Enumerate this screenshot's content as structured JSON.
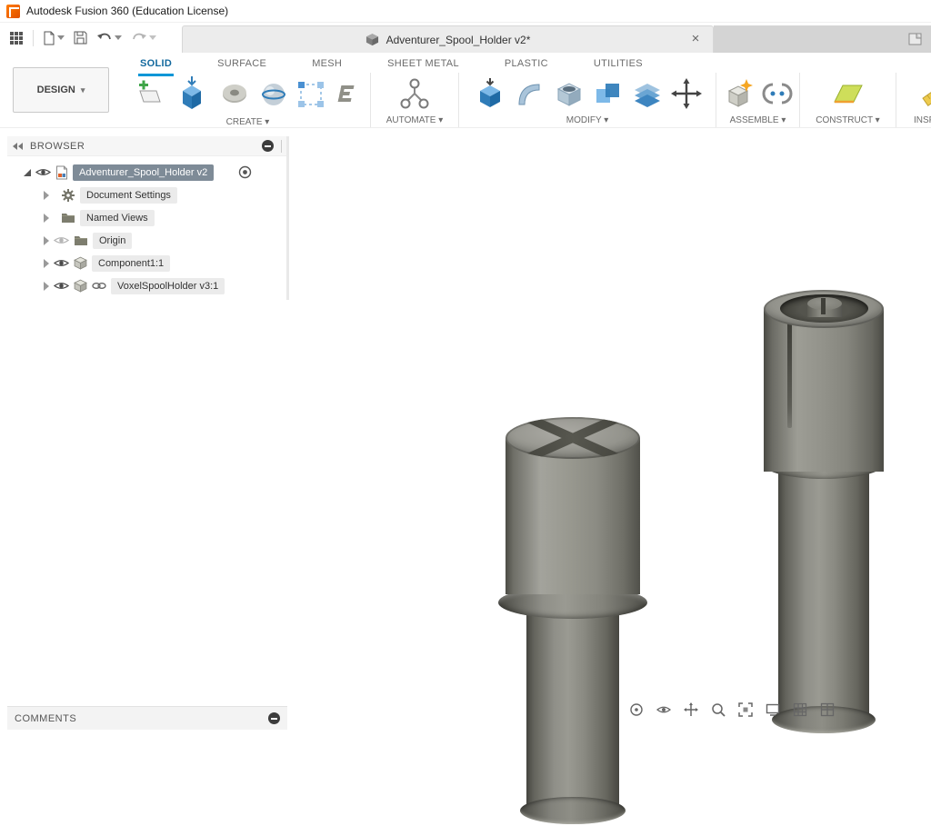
{
  "ui": {
    "caret_down": "▾"
  },
  "title_bar": {
    "app_title": "Autodesk Fusion 360 (Education License)"
  },
  "document_tab": {
    "title": "Adventurer_Spool_Holder v2*",
    "close_glyph": "×"
  },
  "ribbon": {
    "design_menu_label": "DESIGN",
    "tabs": [
      {
        "label": "SOLID",
        "active": true
      },
      {
        "label": "SURFACE"
      },
      {
        "label": "MESH"
      },
      {
        "label": "SHEET METAL"
      },
      {
        "label": "PLASTIC"
      },
      {
        "label": "UTILITIES"
      }
    ],
    "groups": [
      {
        "label": "CREATE"
      },
      {
        "label": "AUTOMATE"
      },
      {
        "label": "MODIFY"
      },
      {
        "label": "ASSEMBLE"
      },
      {
        "label": "CONSTRUCT"
      },
      {
        "label": "INSPECT"
      }
    ]
  },
  "browser_panel": {
    "header": "BROWSER",
    "items": [
      {
        "label": "Adventurer_Spool_Holder v2",
        "selected": true
      },
      {
        "label": "Document Settings"
      },
      {
        "label": "Named Views"
      },
      {
        "label": "Origin",
        "visibility": "hidden"
      },
      {
        "label": "Component1:1"
      },
      {
        "label": "VoxelSpoolHolder v3:1",
        "linked": true
      }
    ]
  },
  "comments_panel": {
    "header": "COMMENTS"
  },
  "colors": {
    "accent_blue": "#0696d7",
    "selection_gray": "#7e8b97",
    "model_base_gray": "#8f8f88"
  }
}
